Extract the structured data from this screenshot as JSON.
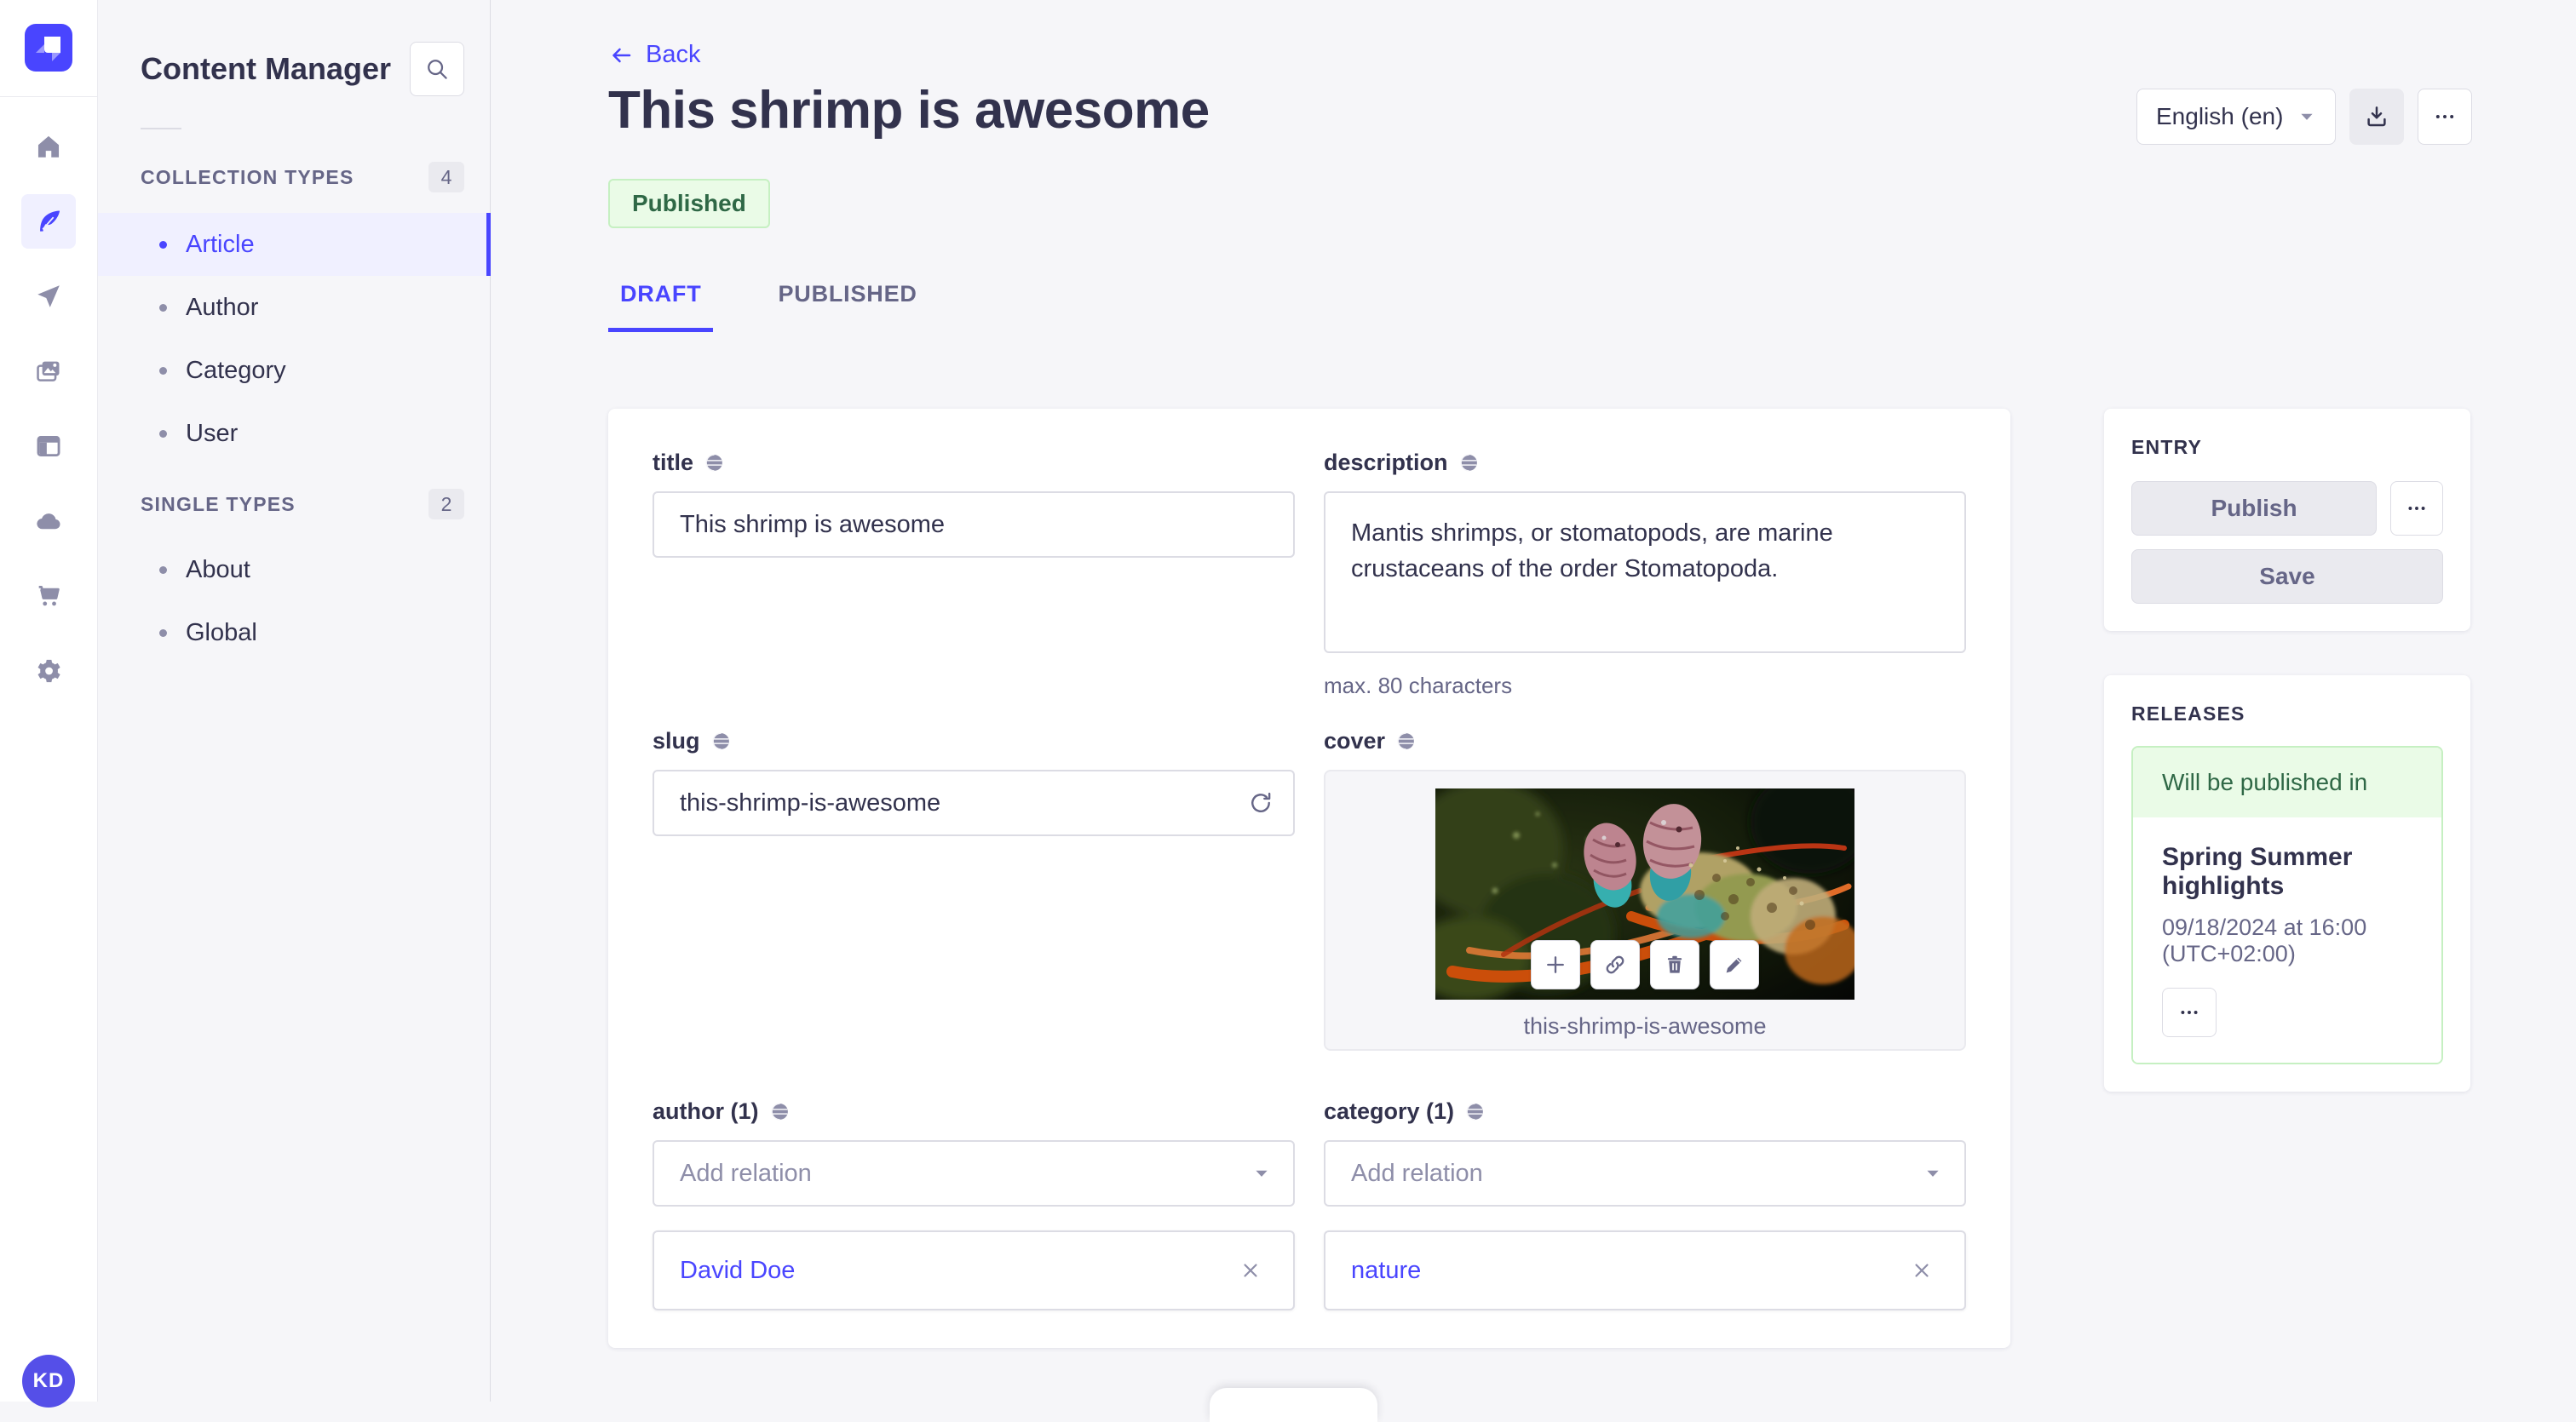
{
  "sidebar": {
    "title": "Content Manager",
    "sections": [
      {
        "label": "COLLECTION TYPES",
        "count": "4",
        "items": [
          {
            "label": "Article"
          },
          {
            "label": "Author"
          },
          {
            "label": "Category"
          },
          {
            "label": "User"
          }
        ]
      },
      {
        "label": "SINGLE TYPES",
        "count": "2",
        "items": [
          {
            "label": "About"
          },
          {
            "label": "Global"
          }
        ]
      }
    ]
  },
  "header": {
    "back_label": "Back",
    "title": "This shrimp is awesome",
    "status_badge": "Published",
    "language": "English (en)",
    "tabs": [
      {
        "label": "DRAFT"
      },
      {
        "label": "PUBLISHED"
      }
    ]
  },
  "form": {
    "title": {
      "label": "title",
      "value": "This shrimp is awesome"
    },
    "description": {
      "label": "description",
      "value": "Mantis shrimps, or stomatopods, are marine crustaceans of the order Stomatopoda.",
      "helper": "max. 80 characters"
    },
    "slug": {
      "label": "slug",
      "value": "this-shrimp-is-awesome"
    },
    "cover": {
      "label": "cover",
      "caption": "this-shrimp-is-awesome"
    },
    "author": {
      "label": "author (1)",
      "placeholder": "Add relation",
      "relation": "David Doe"
    },
    "category": {
      "label": "category (1)",
      "placeholder": "Add relation",
      "relation": "nature"
    }
  },
  "entry_panel": {
    "title": "ENTRY",
    "publish_label": "Publish",
    "save_label": "Save"
  },
  "releases_panel": {
    "title": "RELEASES",
    "status": "Will be published in",
    "release_name": "Spring Summer highlights",
    "release_date": "09/18/2024 at 16:00 (UTC+02:00)"
  },
  "user": {
    "initials": "KD"
  },
  "colors": {
    "accent": "#4945FF",
    "success_bg": "#EAFBE7",
    "success_border": "#C6F0C2",
    "success_text": "#2F6846"
  }
}
